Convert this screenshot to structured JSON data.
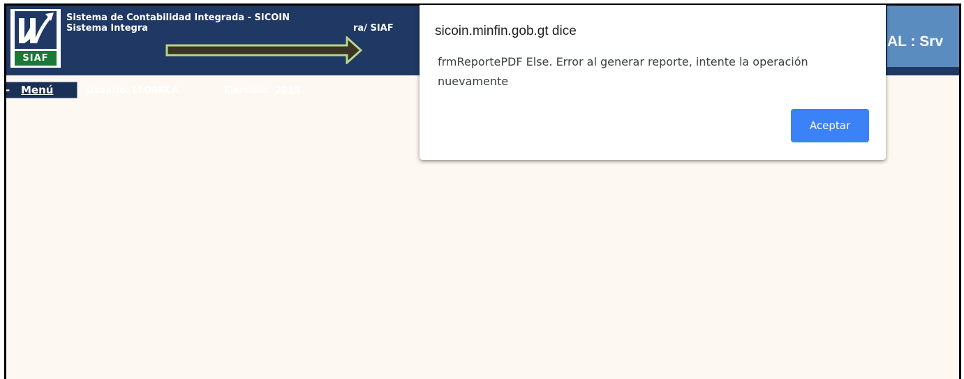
{
  "header": {
    "logo_text": "SIAF",
    "system_title_line1": "Sistema de Contabilidad Integrada - SICOIN",
    "system_title_line2a": "Sistema Integra",
    "system_title_line2b": "ra/ SIAF",
    "right_title": "AL : Srv"
  },
  "nav": {
    "menu_dash": "-",
    "menu_label": "Menú",
    "user_label": "Usuario: LLOARCA",
    "ejercicio_label": "Ejercicio:",
    "ejercicio_year": "2018"
  },
  "dialog": {
    "title": "sicoin.minfin.gob.gt dice",
    "message": "frmReportePDF Else. Error al generar reporte, intente la operación nuevamente",
    "ok_label": "Aceptar"
  },
  "colors": {
    "header_bg": "#1f3864",
    "right_header_bg": "#5b8cbf",
    "content_bg": "#fdf8f1",
    "accept_button": "#3b82f6",
    "arrow_fill": "#3a3424",
    "arrow_stroke": "#b9d48a"
  },
  "icons": {
    "logo": "siaf-logo-icon",
    "annotation": "arrow-right-icon"
  }
}
